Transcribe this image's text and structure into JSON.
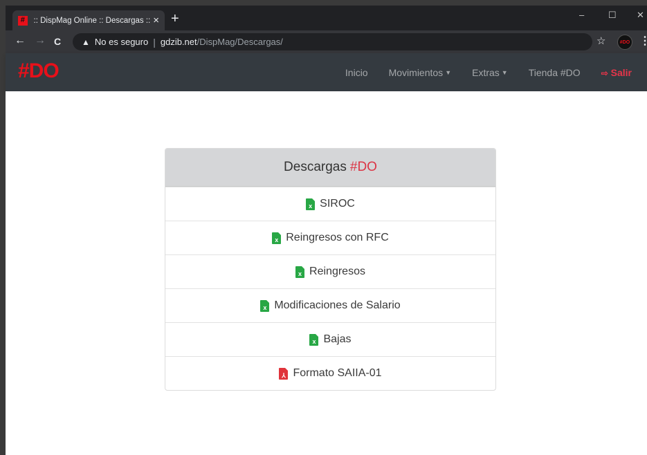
{
  "browser": {
    "tab_title": ":: DispMag Online :: Descargas ::",
    "tab_favicon": "#",
    "tab_close": "×",
    "new_tab": "+",
    "window_controls": {
      "minimize": "–",
      "maximize": "☐",
      "close": "✕"
    },
    "toolbar": {
      "back": "←",
      "forward": "→",
      "reload": "C"
    },
    "address": {
      "warning_icon": "▲",
      "insecure_label": "No es seguro",
      "separator": "|",
      "host": "gdzib.net",
      "path": "/DispMag/Descargas/"
    },
    "star": "☆",
    "extension_label": "#DO",
    "menu": "⋮"
  },
  "navbar": {
    "brand": "#DO",
    "items": [
      {
        "label": "Inicio",
        "dropdown": false
      },
      {
        "label": "Movimientos",
        "dropdown": true
      },
      {
        "label": "Extras",
        "dropdown": true
      },
      {
        "label": "Tienda #DO",
        "dropdown": false
      }
    ],
    "exit": {
      "icon": "sign-out-icon",
      "label": "Salir"
    }
  },
  "downloads": {
    "title": "Descargas",
    "title_accent": "#DO",
    "files": [
      {
        "label": "SIROC",
        "type": "excel",
        "icon": "x"
      },
      {
        "label": "Reingresos con RFC",
        "type": "excel",
        "icon": "x"
      },
      {
        "label": "Reingresos",
        "type": "excel",
        "icon": "x"
      },
      {
        "label": "Modificaciones de Salario",
        "type": "excel",
        "icon": "x"
      },
      {
        "label": "Bajas",
        "type": "excel",
        "icon": "x"
      },
      {
        "label": "Formato SAIIA-01",
        "type": "pdf",
        "icon": "⅄"
      }
    ]
  },
  "colors": {
    "brand_red": "#e8101a",
    "accent_red": "#dc3545",
    "excel_green": "#28a745",
    "pdf_red": "#e0343b",
    "navbar_bg": "#343a40"
  }
}
